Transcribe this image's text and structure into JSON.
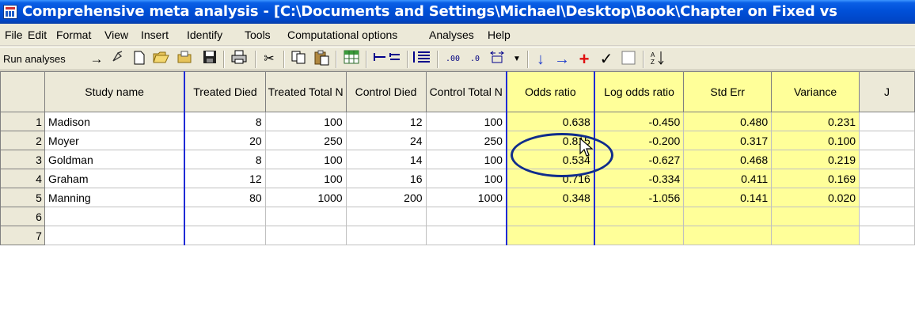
{
  "window": {
    "title": "Comprehensive meta analysis - [C:\\Documents and Settings\\Michael\\Desktop\\Book\\Chapter on Fixed vs"
  },
  "menu": [
    "File",
    "Edit",
    "Format",
    "View",
    "Insert",
    "Identify",
    "Tools",
    "Computational options",
    "Analyses",
    "Help"
  ],
  "toolbar": {
    "run_label": "Run analyses",
    "icons": [
      "arrow-right-icon",
      "pointer-icon",
      "new-file-icon",
      "open-folder-icon",
      "open-file-icon",
      "save-icon",
      "print-icon",
      "cut-icon",
      "copy-icon",
      "paste-icon",
      "table-icon",
      "insert-row-icon",
      "insert-column-icon",
      "list-icon",
      "increase-decimal-icon",
      "decrease-decimal-icon",
      "column-width-icon",
      "dropdown-icon",
      "down-arrow-icon",
      "right-arrow-icon",
      "plus-icon",
      "check-icon",
      "checkbox-icon",
      "sort-icon"
    ],
    "increase_decimals": ".00",
    "decrease_decimals": ".0"
  },
  "grid": {
    "headers": [
      "",
      "Study name",
      "Treated Died",
      "Treated Total N",
      "Control Died",
      "Control Total N",
      "Odds ratio",
      "Log odds ratio",
      "Std Err",
      "Variance",
      "J"
    ],
    "rows": [
      {
        "n": "1",
        "study": "Madison",
        "td": "8",
        "tn": "100",
        "cd": "12",
        "cn": "100",
        "or": "0.638",
        "lor": "-0.450",
        "se": "0.480",
        "var": "0.231"
      },
      {
        "n": "2",
        "study": "Moyer",
        "td": "20",
        "tn": "250",
        "cd": "24",
        "cn": "250",
        "or": "0.815",
        "lor": "-0.200",
        "se": "0.317",
        "var": "0.100"
      },
      {
        "n": "3",
        "study": "Goldman",
        "td": "8",
        "tn": "100",
        "cd": "14",
        "cn": "100",
        "or": "0.534",
        "lor": "-0.627",
        "se": "0.468",
        "var": "0.219"
      },
      {
        "n": "4",
        "study": "Graham",
        "td": "12",
        "tn": "100",
        "cd": "16",
        "cn": "100",
        "or": "0.716",
        "lor": "-0.334",
        "se": "0.411",
        "var": "0.169"
      },
      {
        "n": "5",
        "study": "Manning",
        "td": "80",
        "tn": "1000",
        "cd": "200",
        "cn": "1000",
        "or": "0.348",
        "lor": "-1.056",
        "se": "0.141",
        "var": "0.020"
      },
      {
        "n": "6",
        "study": "",
        "td": "",
        "tn": "",
        "cd": "",
        "cn": "",
        "or": "",
        "lor": "",
        "se": "",
        "var": ""
      },
      {
        "n": "7",
        "study": "",
        "td": "",
        "tn": "",
        "cd": "",
        "cn": "",
        "or": "",
        "lor": "",
        "se": "",
        "var": ""
      }
    ]
  }
}
